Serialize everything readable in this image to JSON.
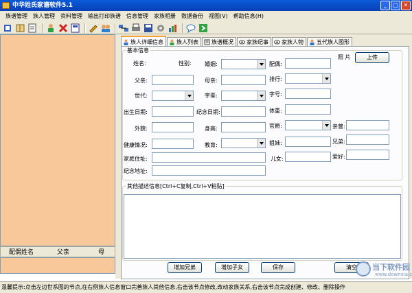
{
  "window": {
    "title": "中华姓氏家谱软件5.1"
  },
  "menu": [
    "族谱管理",
    "族人管理",
    "资料管理",
    "输出打印族谱",
    "信息管理",
    "家族相册",
    "数据备份",
    "视图(V)",
    "帮助信息(H)"
  ],
  "toolbar_icons": [
    "tree-icon",
    "book-icon",
    "open-icon",
    "add-person-icon",
    "delete-icon",
    "info-icon",
    "edit-icon",
    "group-icon",
    "network-icon",
    "print-icon",
    "save-icon",
    "settings-icon",
    "chart-icon",
    "comment-icon",
    "exit-icon"
  ],
  "left_grid": {
    "columns": [
      "配偶姓名",
      "父亲",
      "母"
    ]
  },
  "tabs": [
    "族人详细信息",
    "族人列表",
    "族谱概况",
    "家族纪事",
    "家族人物",
    "五代族人图形"
  ],
  "basic_group": {
    "legend": "基本信息"
  },
  "form": {
    "name": "姓名:",
    "gender": "性别:",
    "marriage": "婚姻:",
    "spouse": "配偶:",
    "photo": "照  片",
    "upload": "上传",
    "father": "父亲:",
    "mother": "母亲:",
    "rank": "排行:",
    "generation": "世代:",
    "word_generation": "字辈:",
    "courtesy": "字号:",
    "birth_date": "出生日期:",
    "memorial_date": "纪念日期:",
    "weight": "体重:",
    "appearance": "外貌:",
    "height": "身高:",
    "official": "官爵:",
    "relatives": "亲曾:",
    "health": "健康情况:",
    "education": "教育:",
    "sisters": "姐妹:",
    "brothers": "兄弟:",
    "home_address": "家庭住址:",
    "children": "儿女:",
    "hobby": "爱好:",
    "memorial_address": "纪念地址:"
  },
  "other_group": {
    "legend": "其他描述信息[Ctrl+C复制,Ctrl+V粘贴]"
  },
  "buttons": {
    "add_brother": "增加兄弟",
    "add_child": "增加子女",
    "save": "保存",
    "clear": "清空"
  },
  "status": "温馨提示:点击左边世系图的节点,在右侧族人信息窗口完善族人其他信息,右击该节点修改,改动家族关系,右击该节点完成创建、修改、删除操作",
  "watermark": {
    "title": "当下软件园",
    "url": "www.downxia.com"
  }
}
